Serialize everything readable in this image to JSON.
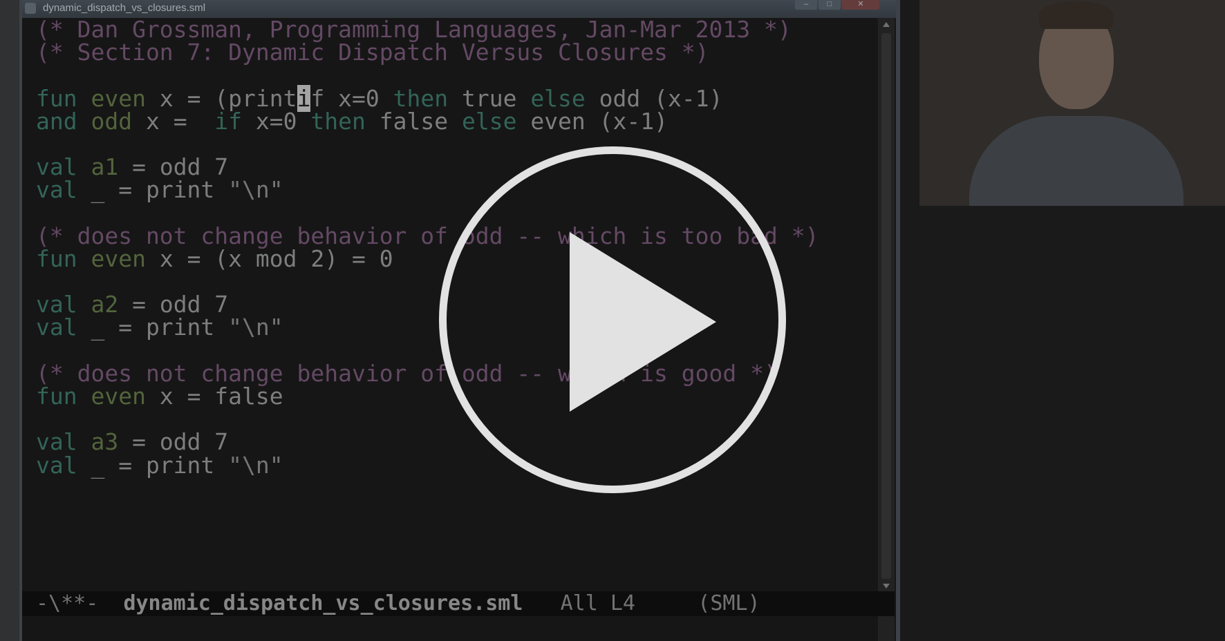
{
  "window": {
    "title": "dynamic_dispatch_vs_closures.sml",
    "buttons": [
      "–",
      "□",
      "✕"
    ]
  },
  "code_lines": [
    [
      {
        "t": "(* Dan Grossman, Programming Languages, Jan-Mar 2013 *)",
        "k": "c"
      }
    ],
    [
      {
        "t": "(* Section 7: Dynamic Dispatch Versus Closures *)",
        "k": "c"
      }
    ],
    [],
    [
      {
        "t": "fun",
        "k": "k"
      },
      {
        "t": " "
      },
      {
        "t": "even",
        "k": "f"
      },
      {
        "t": " x = (print"
      },
      {
        "t": "i",
        "k": "cur"
      },
      {
        "t": "f x=0 "
      },
      {
        "t": "then",
        "k": "k"
      },
      {
        "t": " true "
      },
      {
        "t": "else",
        "k": "k"
      },
      {
        "t": " odd (x-1)"
      }
    ],
    [
      {
        "t": "and",
        "k": "k"
      },
      {
        "t": " "
      },
      {
        "t": "odd",
        "k": "f"
      },
      {
        "t": " x =  "
      },
      {
        "t": "if",
        "k": "k"
      },
      {
        "t": " x=0 "
      },
      {
        "t": "then",
        "k": "k"
      },
      {
        "t": " false "
      },
      {
        "t": "else",
        "k": "k"
      },
      {
        "t": " even (x-1)"
      }
    ],
    [],
    [
      {
        "t": "val",
        "k": "k"
      },
      {
        "t": " "
      },
      {
        "t": "a1",
        "k": "f"
      },
      {
        "t": " = odd 7"
      }
    ],
    [
      {
        "t": "val",
        "k": "k"
      },
      {
        "t": " _ = print "
      },
      {
        "t": "\"\\n\"",
        "k": "s"
      }
    ],
    [],
    [
      {
        "t": "(* does not change behavior of odd -- which is too bad *)",
        "k": "c"
      }
    ],
    [
      {
        "t": "fun",
        "k": "k"
      },
      {
        "t": " "
      },
      {
        "t": "even",
        "k": "f"
      },
      {
        "t": " x = (x mod 2) = 0"
      }
    ],
    [],
    [
      {
        "t": "val",
        "k": "k"
      },
      {
        "t": " "
      },
      {
        "t": "a2",
        "k": "f"
      },
      {
        "t": " = odd 7"
      }
    ],
    [
      {
        "t": "val",
        "k": "k"
      },
      {
        "t": " _ = print "
      },
      {
        "t": "\"\\n\"",
        "k": "s"
      }
    ],
    [],
    [
      {
        "t": "(* does not change behavior of odd -- which is good *)",
        "k": "c"
      }
    ],
    [
      {
        "t": "fun",
        "k": "k"
      },
      {
        "t": " "
      },
      {
        "t": "even",
        "k": "f"
      },
      {
        "t": " x = false"
      }
    ],
    [],
    [
      {
        "t": "val",
        "k": "k"
      },
      {
        "t": " "
      },
      {
        "t": "a3",
        "k": "f"
      },
      {
        "t": " = odd 7"
      }
    ],
    [
      {
        "t": "val",
        "k": "k"
      },
      {
        "t": " _ = print "
      },
      {
        "t": "\"\\n\"",
        "k": "s"
      }
    ]
  ],
  "modeline": {
    "status": "-\\**-  ",
    "filename": "dynamic_dispatch_vs_closures.sml",
    "position": "   All L4     ",
    "mode": "(SML)"
  },
  "player": {
    "play_icon": "play-icon"
  },
  "colors": {
    "comment": "#7a5a7a",
    "keyword": "#3f7a6b",
    "function": "#657a4a",
    "text": "#9a9a9a",
    "background": "#1b1b1b"
  }
}
